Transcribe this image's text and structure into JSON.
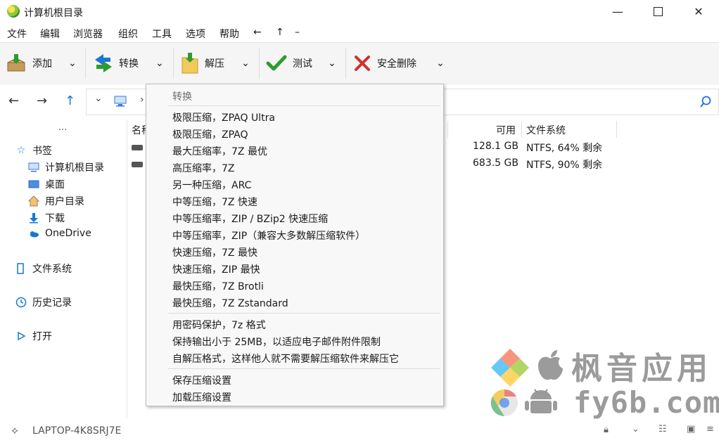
{
  "window": {
    "title": "计算机根目录",
    "min_glyph": "—",
    "max_glyph": "☐",
    "close_glyph": "✕"
  },
  "menubar": {
    "items": [
      "文件",
      "编辑",
      "浏览器",
      "组织",
      "工具",
      "选项",
      "帮助",
      "←",
      "↑",
      "–"
    ]
  },
  "toolbar": {
    "add": "添加",
    "convert": "转换",
    "extract": "解压",
    "test": "测试",
    "secure_delete": "安全删除"
  },
  "navbar": {
    "back": "←",
    "forward": "→",
    "up": "↑",
    "dropdown": "⌄",
    "crumb_arrow": "›"
  },
  "left_pane": {
    "overflow": "...",
    "bookmarks": "书签",
    "bookmark_items": [
      "计算机根目录",
      "桌面",
      "用户目录",
      "下载",
      "OneDrive"
    ],
    "filesystem": "文件系统",
    "history": "历史记录",
    "open": "打开"
  },
  "file_list": {
    "columns": {
      "name": "名称",
      "available": "可用",
      "filesystem": "文件系统"
    },
    "rows": [
      {
        "available": "128.1 GB",
        "filesystem": "NTFS, 64% 剩余"
      },
      {
        "available": "683.5 GB",
        "filesystem": "NTFS, 90% 剩余"
      }
    ]
  },
  "status_bar": {
    "computer": "LAPTOP-4K8SRJ7E"
  },
  "convert_menu": {
    "header": "转换",
    "group1": [
      "极限压缩，ZPAQ Ultra",
      "极限压缩，ZPAQ",
      "最大压缩率，7Z 最优",
      "高压缩率，7Z",
      "另一种压缩，ARC",
      "中等压缩，7Z 快速",
      "中等压缩率，ZIP / BZip2 快速压缩",
      "中等压缩率，ZIP（兼容大多数解压缩软件）",
      "快速压缩，7Z 最快",
      "快速压缩，ZIP 最快",
      "最快压缩，7Z Brotli",
      "最快压缩，7Z Zstandard"
    ],
    "group2": [
      "用密码保护，7z 格式",
      "保持输出小于 25MB，以适应电子邮件附件限制",
      "自解压格式，这样他人就不需要解压缩软件来解压它"
    ],
    "group3": [
      "保存压缩设置",
      "加载压缩设置"
    ]
  },
  "watermark": {
    "line1": "枫音应用",
    "line2": "fy6b.com"
  },
  "colors": {
    "accent_blue": "#1976d2",
    "check_green": "#2e9b2e",
    "delete_red": "#d32f2f"
  }
}
